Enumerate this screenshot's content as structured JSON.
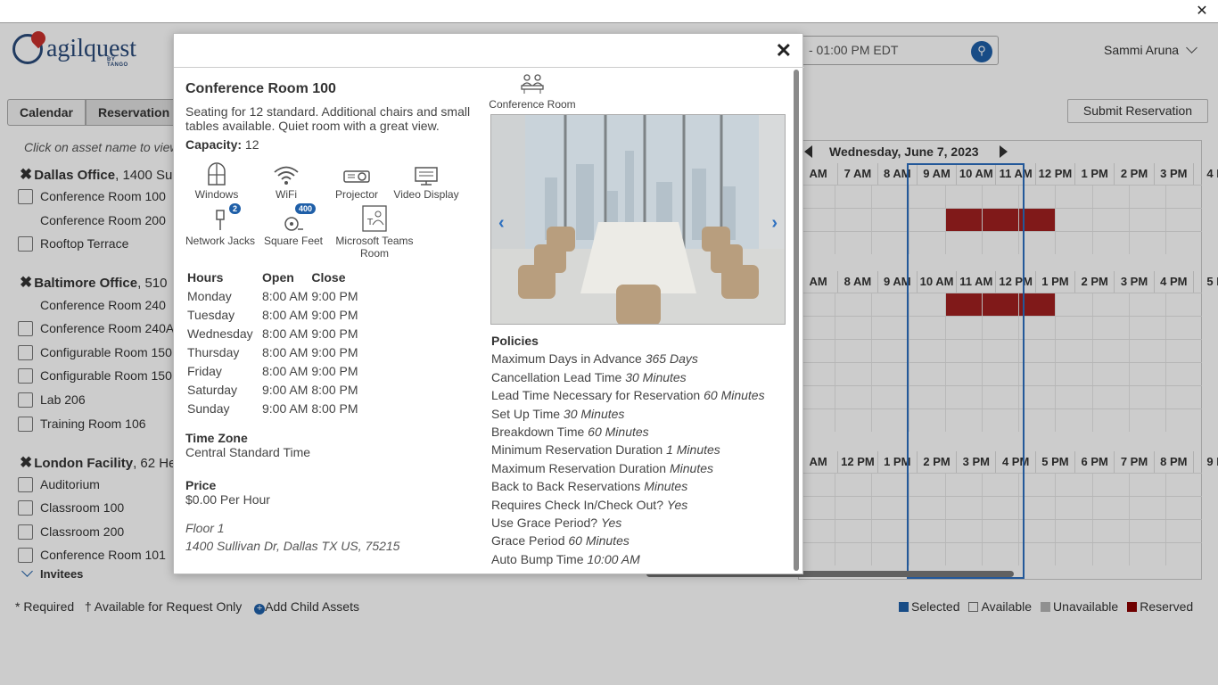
{
  "app": {
    "brand": "agilquest",
    "brand_sub": "BY TANGO",
    "user_name": "Sammi Aruna"
  },
  "search": {
    "value": "- 01:00 PM EDT"
  },
  "tabs": {
    "calendar": "Calendar",
    "reservation": "Reservation s"
  },
  "submit_label": "Submit Reservation",
  "hint": "Click on asset name to view",
  "groups": [
    {
      "name": "Dallas Office",
      "rest": ", 1400 Su",
      "assets": [
        {
          "label": "Conference Room 100",
          "checkbox": true
        },
        {
          "label": "Conference Room 200",
          "checkbox": false
        },
        {
          "label": "Rooftop Terrace",
          "checkbox": true
        }
      ]
    },
    {
      "name": "Baltimore Office",
      "rest": ", 510",
      "assets": [
        {
          "label": "Conference Room 240",
          "checkbox": false
        },
        {
          "label": "Conference Room 240A",
          "checkbox": true
        },
        {
          "label": "Configurable Room 150.",
          "checkbox": true
        },
        {
          "label": "Configurable Room 150",
          "checkbox": true
        },
        {
          "label": "Lab 206",
          "checkbox": true
        },
        {
          "label": "Training Room 106",
          "checkbox": true
        }
      ]
    },
    {
      "name": "London Facility",
      "rest": ", 62 He",
      "assets": [
        {
          "label": "Auditorium",
          "checkbox": true
        },
        {
          "label": "Classroom 100",
          "checkbox": true
        },
        {
          "label": "Classroom 200",
          "checkbox": true
        },
        {
          "label": "Conference Room 101",
          "checkbox": true
        }
      ]
    }
  ],
  "invitees_label": "Invitees",
  "footer": {
    "required": "* Required",
    "request_only": "† Available for Request Only",
    "add_child": "Add Child Assets"
  },
  "legend": [
    {
      "label": "Selected",
      "color": "#1f5fa8"
    },
    {
      "label": "Available",
      "color": "#ffffff"
    },
    {
      "label": "Unavailable",
      "color": "#b5b5b5"
    },
    {
      "label": "Reserved",
      "color": "#8b0000"
    }
  ],
  "calendar": {
    "date": "Wednesday, June 7, 2023",
    "rows": [
      {
        "hours": [
          "AM",
          "7 AM",
          "8 AM",
          "9 AM",
          "10 AM",
          "11 AM",
          "12 PM",
          "1 PM",
          "2 PM",
          "3 PM",
          "4 I"
        ]
      },
      {
        "hours": [
          "AM",
          "8 AM",
          "9 AM",
          "10 AM",
          "11 AM",
          "12 PM",
          "1 PM",
          "2 PM",
          "3 PM",
          "4 PM",
          "5 I"
        ]
      },
      {
        "hours": [
          "AM",
          "12 PM",
          "1 PM",
          "2 PM",
          "3 PM",
          "4 PM",
          "5 PM",
          "6 PM",
          "7 PM",
          "8 PM",
          "9 I"
        ]
      }
    ]
  },
  "modal": {
    "title": "Conference Room 100",
    "description": "Seating for 12 standard. Additional chairs and small tables available. Quiet room with a great view.",
    "capacity_label": "Capacity:",
    "capacity": "12",
    "asset_type": "Conference Room",
    "amenities": [
      {
        "label": "Windows",
        "icon": "windows-icon"
      },
      {
        "label": "WiFi",
        "icon": "wifi-icon"
      },
      {
        "label": "Projector",
        "icon": "projector-icon"
      },
      {
        "label": "Video Display",
        "icon": "video-display-icon"
      },
      {
        "label": "Network Jacks",
        "icon": "network-jack-icon",
        "badge": "2"
      },
      {
        "label": "Square Feet",
        "icon": "tape-measure-icon",
        "badge": "400"
      },
      {
        "label": "Microsoft Teams Room",
        "icon": "teams-room-icon"
      }
    ],
    "hours_header": {
      "day": "Hours",
      "open": "Open",
      "close": "Close"
    },
    "hours": [
      {
        "day": "Monday",
        "open": "8:00 AM",
        "close": "9:00 PM"
      },
      {
        "day": "Tuesday",
        "open": "8:00 AM",
        "close": "9:00 PM"
      },
      {
        "day": "Wednesday",
        "open": "8:00 AM",
        "close": "9:00 PM"
      },
      {
        "day": "Thursday",
        "open": "8:00 AM",
        "close": "9:00 PM"
      },
      {
        "day": "Friday",
        "open": "8:00 AM",
        "close": "9:00 PM"
      },
      {
        "day": "Saturday",
        "open": "9:00 AM",
        "close": "8:00 PM"
      },
      {
        "day": "Sunday",
        "open": "9:00 AM",
        "close": "8:00 PM"
      }
    ],
    "timezone_label": "Time Zone",
    "timezone": "Central Standard Time",
    "price_label": "Price",
    "price": "$0.00 Per Hour",
    "floor": "Floor 1",
    "address": "1400 Sullivan Dr, Dallas TX US, 75215",
    "policies_label": "Policies",
    "policies": [
      {
        "label": "Maximum Days in Advance",
        "value": "365 Days"
      },
      {
        "label": "Cancellation Lead Time",
        "value": "30 Minutes"
      },
      {
        "label": "Lead Time Necessary for Reservation",
        "value": "60 Minutes"
      },
      {
        "label": "Set Up Time",
        "value": "30 Minutes"
      },
      {
        "label": "Breakdown Time",
        "value": "60 Minutes"
      },
      {
        "label": "Minimum Reservation Duration",
        "value": "1 Minutes"
      },
      {
        "label": "Maximum Reservation Duration",
        "value": "Minutes"
      },
      {
        "label": "Back to Back Reservations",
        "value": "Minutes"
      },
      {
        "label": "Requires Check In/Check Out?",
        "value": "Yes"
      },
      {
        "label": "Use Grace Period?",
        "value": "Yes"
      },
      {
        "label": "Grace Period",
        "value": "60 Minutes"
      },
      {
        "label": "Auto Bump Time",
        "value": "10:00 AM"
      }
    ]
  }
}
